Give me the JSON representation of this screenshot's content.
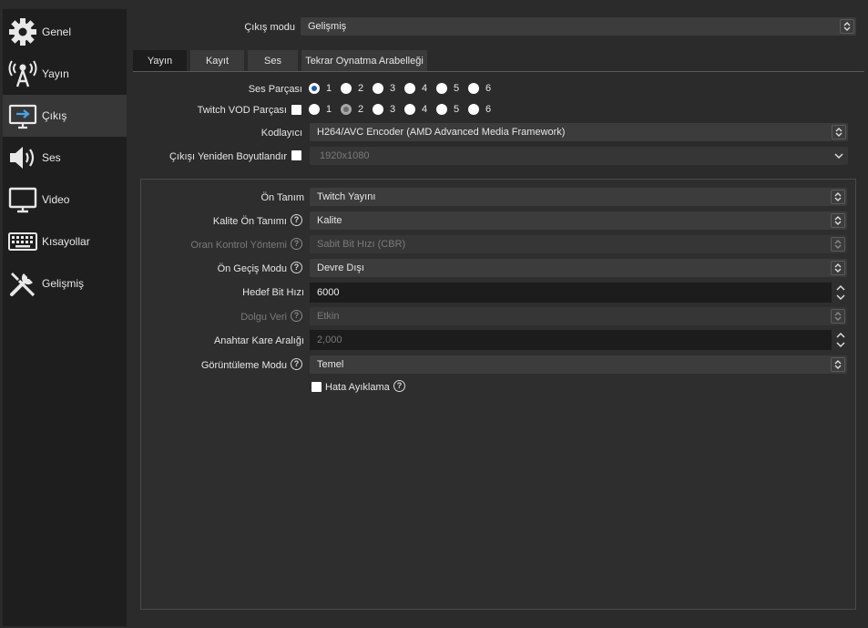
{
  "sidebar": {
    "items": [
      {
        "label": "Genel",
        "icon": "gear-icon"
      },
      {
        "label": "Yayın",
        "icon": "antenna-icon"
      },
      {
        "label": "Çıkış",
        "icon": "output-icon"
      },
      {
        "label": "Ses",
        "icon": "speaker-icon"
      },
      {
        "label": "Video",
        "icon": "monitor-icon"
      },
      {
        "label": "Kısayollar",
        "icon": "keyboard-icon"
      },
      {
        "label": "Gelişmiş",
        "icon": "tools-icon"
      }
    ],
    "active_index": 2
  },
  "output_mode": {
    "label": "Çıkış modu",
    "value": "Gelişmiş"
  },
  "tabs": [
    {
      "label": "Yayın",
      "active": true
    },
    {
      "label": "Kayıt",
      "active": false
    },
    {
      "label": "Ses",
      "active": false
    },
    {
      "label": "Tekrar Oynatma Arabelleği",
      "active": false
    }
  ],
  "audio_track": {
    "label": "Ses Parçası",
    "options": [
      "1",
      "2",
      "3",
      "4",
      "5",
      "6"
    ],
    "selected": "1"
  },
  "twitch_vod": {
    "label": "Twitch VOD Parçası",
    "options": [
      "1",
      "2",
      "3",
      "4",
      "5",
      "6"
    ],
    "selected": "2"
  },
  "encoder": {
    "label": "Kodlayıcı",
    "value": "H264/AVC Encoder (AMD Advanced Media Framework)"
  },
  "rescale": {
    "label": "Çıkışı Yeniden Boyutlandır",
    "value": "1920x1080"
  },
  "settings": {
    "preset": {
      "label": "Ön Tanım",
      "value": "Twitch Yayını"
    },
    "quality_preset": {
      "label": "Kalite Ön Tanımı",
      "value": "Kalite"
    },
    "rate_control": {
      "label": "Oran Kontrol Yöntemi",
      "value": "Sabit Bit Hızı (CBR)"
    },
    "prepass": {
      "label": "Ön Geçiş Modu",
      "value": "Devre Dışı"
    },
    "target_bitrate": {
      "label": "Hedef Bit Hızı",
      "value": "6000"
    },
    "filler_data": {
      "label": "Dolgu Veri",
      "value": "Etkin"
    },
    "keyframe_interval": {
      "label": "Anahtar Kare Aralığı",
      "value": "2,000"
    },
    "view_mode": {
      "label": "Görüntüleme Modu",
      "value": "Temel"
    },
    "debug": {
      "label": "Hata Ayıklama",
      "checked": false
    }
  },
  "colors": {
    "accent": "#1a5ea8",
    "background": "#2b2b2b",
    "sidebar": "#1e1e1e"
  }
}
